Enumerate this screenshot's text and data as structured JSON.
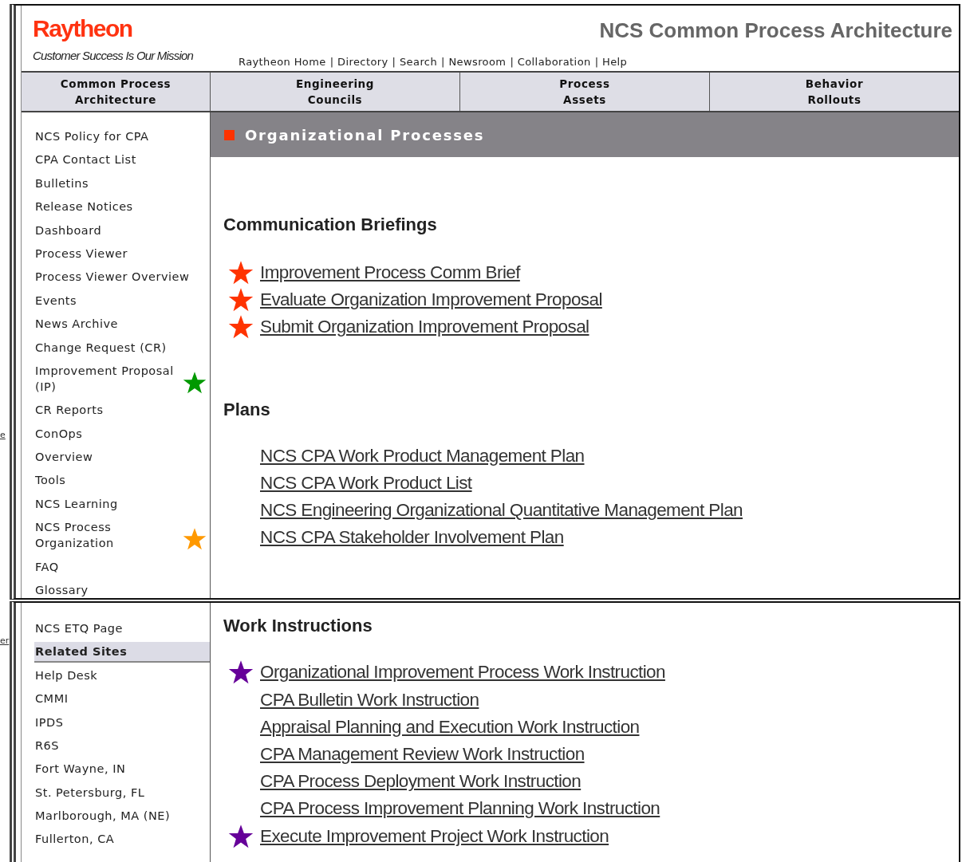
{
  "background_fragments": [
    "e",
    "er"
  ],
  "header": {
    "logo": "Raytheon",
    "tagline": "Customer Success Is Our Mission",
    "title": "NCS Common Process Architecture",
    "separator": "|",
    "utility_links": [
      "Raytheon Home",
      "Directory",
      "Search",
      "Newsroom",
      "Collaboration",
      "Help"
    ]
  },
  "nav_tabs": [
    {
      "label": "Common Process\nArchitecture"
    },
    {
      "label": "Engineering\nCouncils"
    },
    {
      "label": "Process\nAssets"
    },
    {
      "label": "Behavior\nRollouts"
    }
  ],
  "sidebar": {
    "items": [
      {
        "text": "NCS Policy for CPA"
      },
      {
        "text": "CPA Contact List"
      },
      {
        "text": "Bulletins"
      },
      {
        "text": "Release Notices"
      },
      {
        "text": "Dashboard"
      },
      {
        "text": "Process Viewer"
      },
      {
        "text": "Process Viewer Overview"
      },
      {
        "text": "Events"
      },
      {
        "text": "News Archive"
      },
      {
        "text": "Change Request (CR)"
      },
      {
        "text": "Improvement Proposal (IP)",
        "color": "#009900"
      },
      {
        "text": "CR Reports"
      },
      {
        "text": "ConOps"
      },
      {
        "text": "Overview"
      },
      {
        "text": "Tools"
      },
      {
        "text": "NCS Learning"
      },
      {
        "text": "NCS Process Organization",
        "color": "#ff9900"
      },
      {
        "text": "FAQ"
      },
      {
        "text": "Glossary"
      }
    ]
  },
  "banner": {
    "title": "Organizational Processes"
  },
  "sections": [
    {
      "heading": "Communication Briefings",
      "links": [
        {
          "text": "Improvement Process Comm Brief",
          "color": "#ff3300"
        },
        {
          "text": "Evaluate Organization Improvement Proposal",
          "color": "#ff3300"
        },
        {
          "text": "Submit Organization Improvement Proposal",
          "color": "#ff3300"
        }
      ]
    },
    {
      "heading": "Plans",
      "links": [
        {
          "text": "NCS CPA Work Product Management Plan"
        },
        {
          "text": "NCS CPA Work Product List"
        },
        {
          "text": "NCS Engineering Organizational Quantitative Management Plan"
        },
        {
          "text": "NCS CPA Stakeholder Involvement Plan"
        }
      ]
    }
  ],
  "lower_sidebar": {
    "items": [
      {
        "kind": "link",
        "text": "NCS ETQ Page"
      },
      {
        "kind": "heading",
        "text": "Related Sites"
      },
      {
        "kind": "link",
        "text": "Help Desk"
      },
      {
        "kind": "link",
        "text": "CMMI"
      },
      {
        "kind": "link",
        "text": "IPDS"
      },
      {
        "kind": "link",
        "text": "R6S"
      },
      {
        "kind": "link",
        "text": "Fort Wayne, IN"
      },
      {
        "kind": "link",
        "text": "St. Petersburg, FL"
      },
      {
        "kind": "link",
        "text": "Marlborough, MA (NE)"
      },
      {
        "kind": "link",
        "text": "Fullerton, CA"
      }
    ]
  },
  "lower_section": {
    "heading": "Work Instructions",
    "links": [
      {
        "text": "Organizational Improvement Process Work Instruction",
        "color": "#660099"
      },
      {
        "text": "CPA Bulletin Work Instruction"
      },
      {
        "text": "Appraisal Planning and Execution Work Instruction"
      },
      {
        "text": "CPA Management Review Work Instruction"
      },
      {
        "text": "CPA Process Deployment Work Instruction"
      },
      {
        "text": "CPA Process Improvement Planning Work Instruction"
      },
      {
        "text": "Execute Improvement Project Work Instruction",
        "color": "#660099"
      }
    ]
  }
}
